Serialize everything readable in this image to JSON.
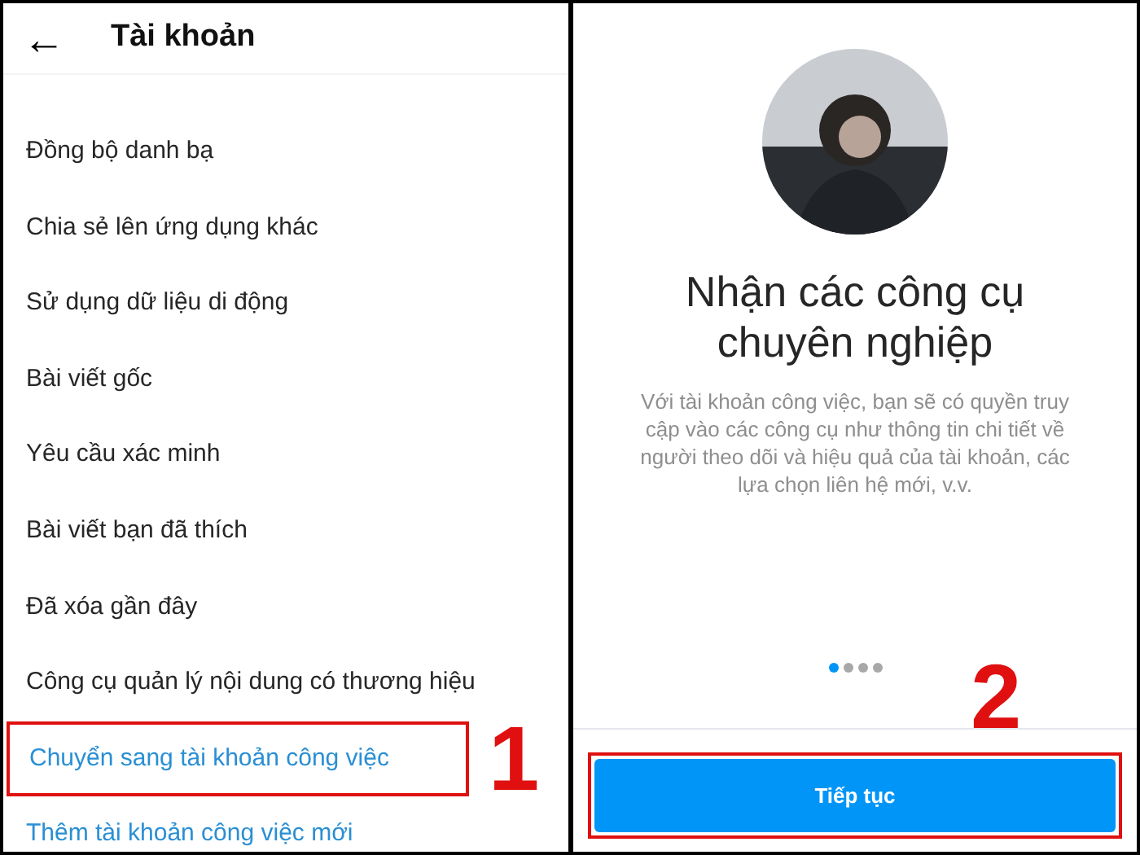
{
  "left_panel": {
    "header": {
      "back": "←",
      "title": "Tài khoản"
    },
    "items": [
      {
        "label": "Đồng bộ danh bạ",
        "kind": "normal",
        "highlighted": false
      },
      {
        "label": "Chia sẻ lên ứng dụng khác",
        "kind": "normal",
        "highlighted": false
      },
      {
        "label": "Sử dụng dữ liệu di động",
        "kind": "normal",
        "highlighted": false
      },
      {
        "label": "Bài viết gốc",
        "kind": "normal",
        "highlighted": false
      },
      {
        "label": "Yêu cầu xác minh",
        "kind": "normal",
        "highlighted": false
      },
      {
        "label": "Bài viết bạn đã thích",
        "kind": "normal",
        "highlighted": false
      },
      {
        "label": "Đã xóa gần đây",
        "kind": "normal",
        "highlighted": false
      },
      {
        "label": "Công cụ quản lý nội dung có thương hiệu",
        "kind": "normal",
        "highlighted": false
      },
      {
        "label": "Chuyển sang tài khoản công việc",
        "kind": "link",
        "highlighted": true
      },
      {
        "label": "Thêm tài khoản công việc mới",
        "kind": "link",
        "highlighted": false
      }
    ],
    "step": "1"
  },
  "right_panel": {
    "title": "Nhận các công cụ chuyên nghiệp",
    "description": "Với tài khoản công việc, bạn sẽ có quyền truy cập vào các công cụ như thông tin chi tiết về người theo dõi và hiệu quả của tài khoản, các lựa chọn liên hệ mới, v.v.",
    "pager": [
      {
        "selected": true
      },
      {
        "selected": false
      },
      {
        "selected": false
      },
      {
        "selected": false
      }
    ],
    "step": "2",
    "button": {
      "label": "Tiếp tục",
      "highlighted": true
    }
  }
}
